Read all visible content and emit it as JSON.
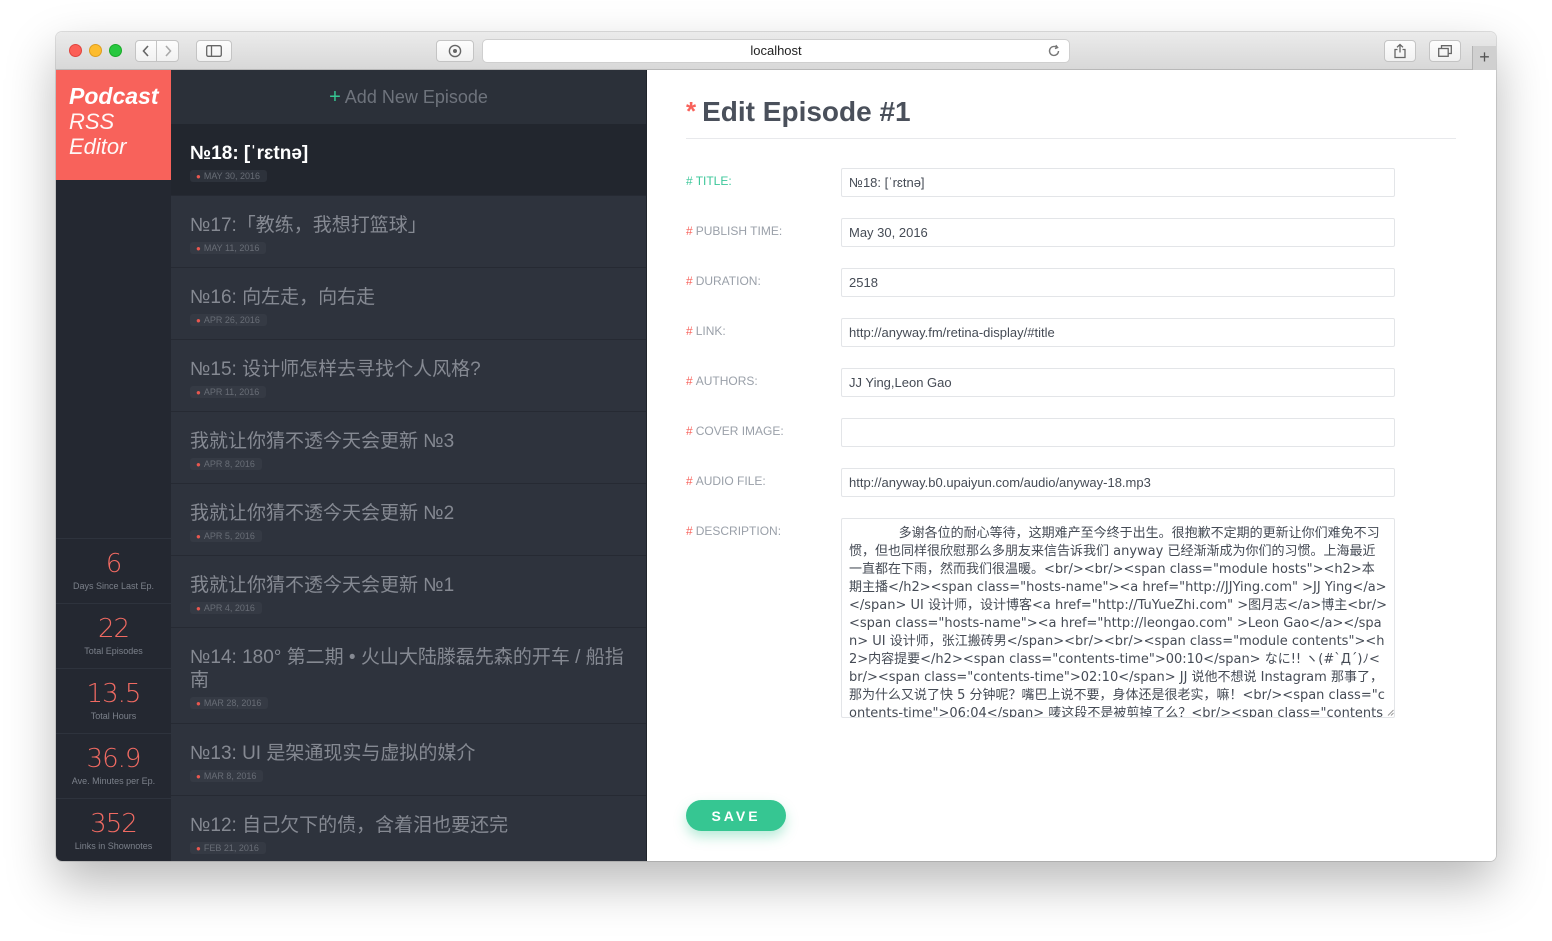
{
  "browser": {
    "url": "localhost"
  },
  "app": {
    "logo": {
      "line1": "Podcast",
      "line2": "RSS",
      "line3": "Editor"
    },
    "add_episode_label": "Add New Episode"
  },
  "stats": [
    {
      "value": "6",
      "label": "Days Since Last Ep."
    },
    {
      "value": "22",
      "label": "Total Episodes"
    },
    {
      "value": "13.5",
      "label": "Total Hours"
    },
    {
      "value": "36.9",
      "label": "Ave. Minutes per Ep."
    },
    {
      "value": "352",
      "label": "Links in Shownotes"
    }
  ],
  "episodes": [
    {
      "title": "№18: [ˈrɛtnə]",
      "date": "MAY 30, 2016",
      "active": true
    },
    {
      "title": "№17:「教练，我想打篮球」",
      "date": "MAY 11, 2016"
    },
    {
      "title": "№16: 向左走，向右走",
      "date": "APR 26, 2016"
    },
    {
      "title": "№15: 设计师怎样去寻找个人风格?",
      "date": "APR 11, 2016"
    },
    {
      "title": "我就让你猜不透今天会更新 №3",
      "date": "APR 8, 2016"
    },
    {
      "title": "我就让你猜不透今天会更新 №2",
      "date": "APR 5, 2016"
    },
    {
      "title": "我就让你猜不透今天会更新 №1",
      "date": "APR 4, 2016"
    },
    {
      "title": "№14: 180° 第二期 • 火山大陆滕磊先森的开车 / 船指南",
      "date": "MAR 28, 2016"
    },
    {
      "title": "№13: UI 是架通现实与虚拟的媒介",
      "date": "MAR 8, 2016"
    },
    {
      "title": "№12: 自己欠下的债，含着泪也要还完",
      "date": "FEB 21, 2016"
    }
  ],
  "editor": {
    "heading": "Edit Episode #1",
    "fields": {
      "title": {
        "label": "TITLE:",
        "value": "№18: [ˈrɛtnə]"
      },
      "publish_time": {
        "label": "PUBLISH TIME:",
        "value": "May 30, 2016"
      },
      "duration": {
        "label": "DURATION:",
        "value": "2518"
      },
      "link": {
        "label": "LINK:",
        "value": "http://anyway.fm/retina-display/#title"
      },
      "authors": {
        "label": "AUTHORS:",
        "value": "JJ Ying,Leon Gao"
      },
      "cover_image": {
        "label": "COVER IMAGE:",
        "value": ""
      },
      "audio_file": {
        "label": "AUDIO FILE:",
        "value": "http://anyway.b0.upaiyun.com/audio/anyway-18.mp3"
      },
      "description": {
        "label": "DESCRIPTION:",
        "value": "            多谢各位的耐心等待，这期难产至今终于出生。很抱歉不定期的更新让你们难免不习惯，但也同样很欣慰那么多朋友来信告诉我们 anyway 已经渐渐成为你们的习惯。上海最近一直都在下雨，然而我们很温暖。<br/><br/><span class=\"module hosts\"><h2>本期主播</h2><span class=\"hosts-name\"><a href=\"http://JJYing.com\" >JJ Ying</a></span> UI 设计师，设计博客<a href=\"http://TuYueZhi.com\" >图月志</a>博主<br/><span class=\"hosts-name\"><a href=\"http://leongao.com\" >Leon Gao</a></span> UI 设计师，张江搬砖男</span><br/><br/><span class=\"module contents\"><h2>内容提要</h2><span class=\"contents-time\">00:10</span> なに!! ヽ(#`Д´)ﾉ<br/><span class=\"contents-time\">02:10</span> JJ 说他不想说 Instagram 那事了，那为什么又说了快 5 分钟呢？嘴巴上说不要，身体还是很老实，嘛！<br/><span class=\"contents-time\">06:04</span> 唛这段不是被剪掉了么？<br/><span class=\"contents-"
      }
    },
    "save_label": "SAVE"
  }
}
